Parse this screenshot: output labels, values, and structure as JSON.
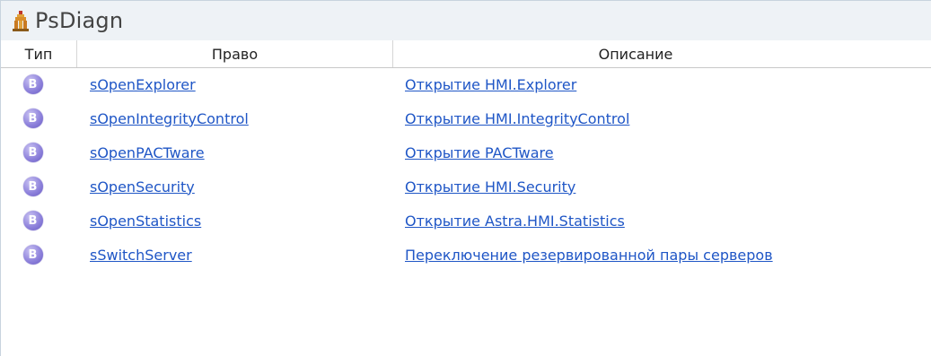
{
  "panel": {
    "title": "PsDiagn",
    "icon": "tower-icon"
  },
  "table": {
    "columns": [
      "Тип",
      "Право",
      "Описание"
    ],
    "type_badge": "B",
    "rows": [
      {
        "right": "sOpenExplorer",
        "description": "Открытие HMI.Explorer"
      },
      {
        "right": "sOpenIntegrityControl",
        "description": "Открытие HMI.IntegrityControl"
      },
      {
        "right": "sOpenPACTware",
        "description": "Открытие PACTware"
      },
      {
        "right": "sOpenSecurity",
        "description": "Открытие HMI.Security"
      },
      {
        "right": "sOpenStatistics",
        "description": "Открытие Astra.HMI.Statistics"
      },
      {
        "right": "sSwitchServer",
        "description": "Переключение резервированной пары серверов"
      }
    ]
  },
  "colors": {
    "link": "#1f56c6",
    "badge": "#8f83dc",
    "title_bar": "#eef2f6"
  }
}
